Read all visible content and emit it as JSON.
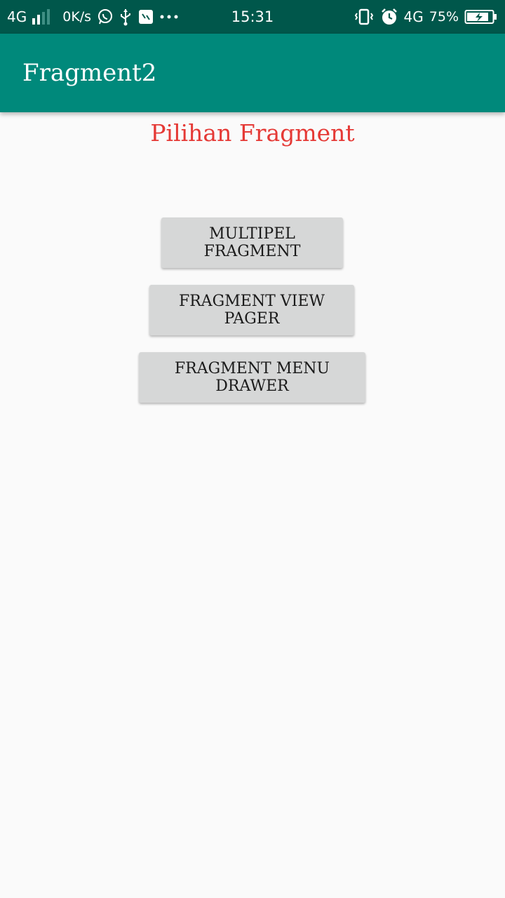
{
  "status_bar": {
    "network_left": "4G",
    "speed": "0K/s",
    "time": "15:31",
    "network_right": "4G",
    "battery": "75%",
    "icons": [
      "signal-icon",
      "whatsapp-icon",
      "usb-icon",
      "app-notification-icon",
      "more-dots-icon",
      "vibrate-icon",
      "alarm-icon",
      "battery-charging-icon"
    ]
  },
  "app_bar": {
    "title": "Fragment2"
  },
  "main": {
    "heading": "Pilihan Fragment",
    "buttons": [
      {
        "label": "MULTIPEL FRAGMENT"
      },
      {
        "label": "FRAGMENT VIEW PAGER"
      },
      {
        "label": "FRAGMENT MENU DRAWER"
      }
    ]
  },
  "colors": {
    "status_bar": "#00574b",
    "app_bar": "#00897b",
    "heading": "#e53935",
    "button_bg": "#d6d7d7",
    "background": "#fafafa"
  }
}
